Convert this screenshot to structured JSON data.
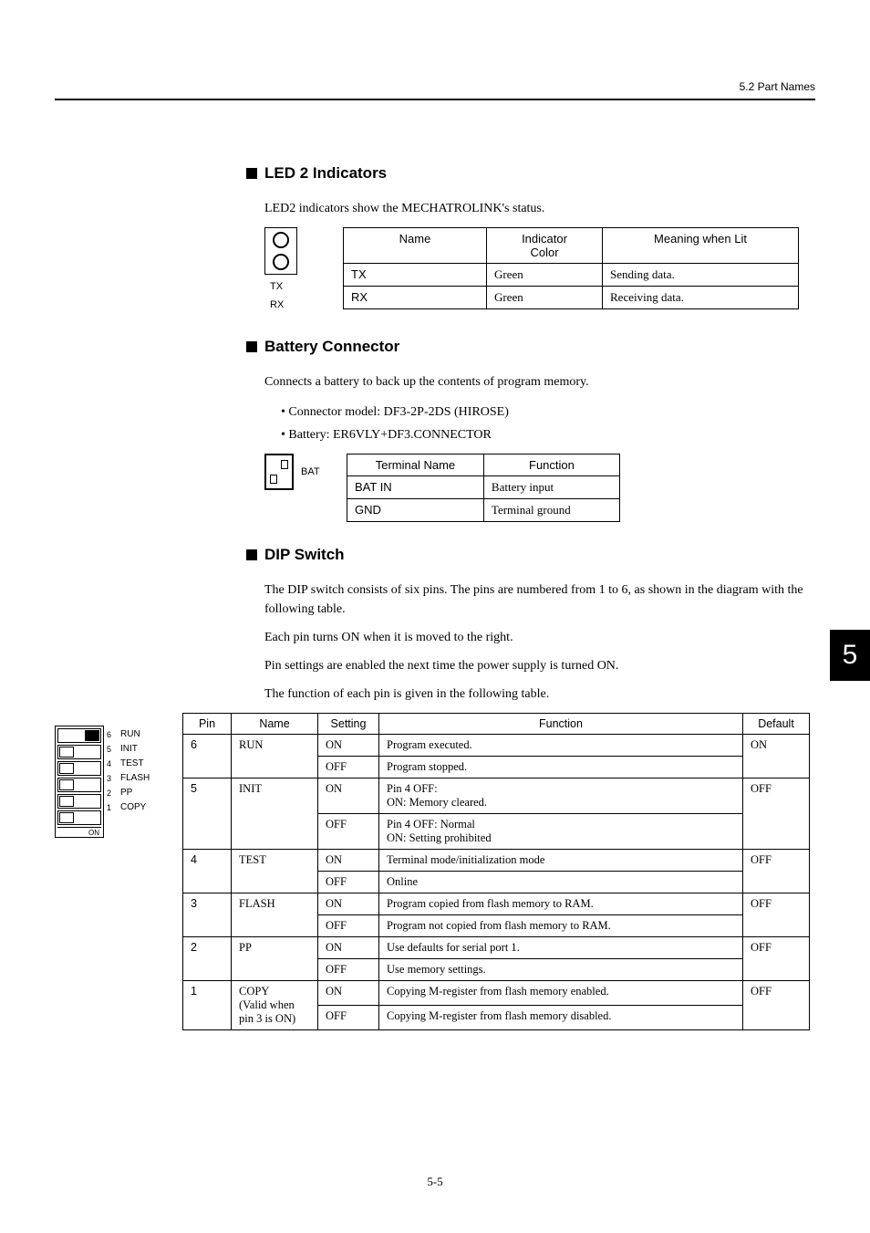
{
  "header": {
    "section": "5.2  Part Names"
  },
  "side_tab": "5",
  "footer": "5-5",
  "led2": {
    "title": "LED 2 Indicators",
    "intro": "LED2 indicators show the MECHATROLINK's status.",
    "diag_labels": {
      "tx": "TX",
      "rx": "RX"
    },
    "headers": {
      "name": "Name",
      "color": "Indicator\nColor",
      "meaning": "Meaning when Lit"
    },
    "rows": [
      {
        "name": "TX",
        "color": "Green",
        "meaning": "Sending data."
      },
      {
        "name": "RX",
        "color": "Green",
        "meaning": "Receiving data."
      }
    ]
  },
  "battery": {
    "title": "Battery Connector",
    "intro": "Connects a battery to back up the contents of program memory.",
    "bullets": [
      "Connector model: DF3-2P-2DS (HIROSE)",
      "Battery: ER6VLY+DF3.CONNECTOR"
    ],
    "diag_label": "BAT",
    "headers": {
      "term": "Terminal Name",
      "func": "Function"
    },
    "rows": [
      {
        "term": "BAT IN",
        "func": "Battery input"
      },
      {
        "term": "GND",
        "func": "Terminal ground"
      }
    ]
  },
  "dip": {
    "title": "DIP Switch",
    "p1": "The DIP switch consists of six pins. The pins are numbered from 1 to 6, as shown in the diagram with the following table.",
    "p2": "Each pin turns ON when it is moved to the right.",
    "p3": "Pin settings are enabled the next time the power supply is turned ON.",
    "p4": "The function of each pin is given in the following table.",
    "on_label": "ON",
    "pin_nums": [
      "6",
      "5",
      "4",
      "3",
      "2",
      "1"
    ],
    "pin_names": [
      "RUN",
      "INIT",
      "TEST",
      "FLASH",
      "PP",
      "COPY"
    ],
    "headers": {
      "pin": "Pin",
      "name": "Name",
      "setting": "Setting",
      "func": "Function",
      "def": "Default"
    },
    "rows": [
      {
        "pin": "6",
        "name": "RUN",
        "default": "ON",
        "settings": [
          {
            "s": "ON",
            "f": "Program executed."
          },
          {
            "s": "OFF",
            "f": "Program stopped."
          }
        ]
      },
      {
        "pin": "5",
        "name": "INIT",
        "default": "OFF",
        "settings": [
          {
            "s": "ON",
            "f": "Pin 4   OFF:\n            ON: Memory cleared."
          },
          {
            "s": "OFF",
            "f": "Pin 4   OFF: Normal\n            ON: Setting prohibited"
          }
        ]
      },
      {
        "pin": "4",
        "name": "TEST",
        "default": "OFF",
        "settings": [
          {
            "s": "ON",
            "f": "Terminal mode/initialization mode"
          },
          {
            "s": "OFF",
            "f": "Online"
          }
        ]
      },
      {
        "pin": "3",
        "name": "FLASH",
        "default": "OFF",
        "settings": [
          {
            "s": "ON",
            "f": "Program copied from flash memory to RAM."
          },
          {
            "s": "OFF",
            "f": "Program not copied from flash memory to RAM."
          }
        ]
      },
      {
        "pin": "2",
        "name": "PP",
        "default": "OFF",
        "settings": [
          {
            "s": "ON",
            "f": "Use defaults for serial port 1."
          },
          {
            "s": "OFF",
            "f": "Use memory settings."
          }
        ]
      },
      {
        "pin": "1",
        "name": "COPY\n(Valid when pin 3 is ON)",
        "default": "OFF",
        "settings": [
          {
            "s": "ON",
            "f": "Copying M-register from flash memory enabled."
          },
          {
            "s": "OFF",
            "f": "Copying M-register from flash memory disabled."
          }
        ]
      }
    ]
  }
}
